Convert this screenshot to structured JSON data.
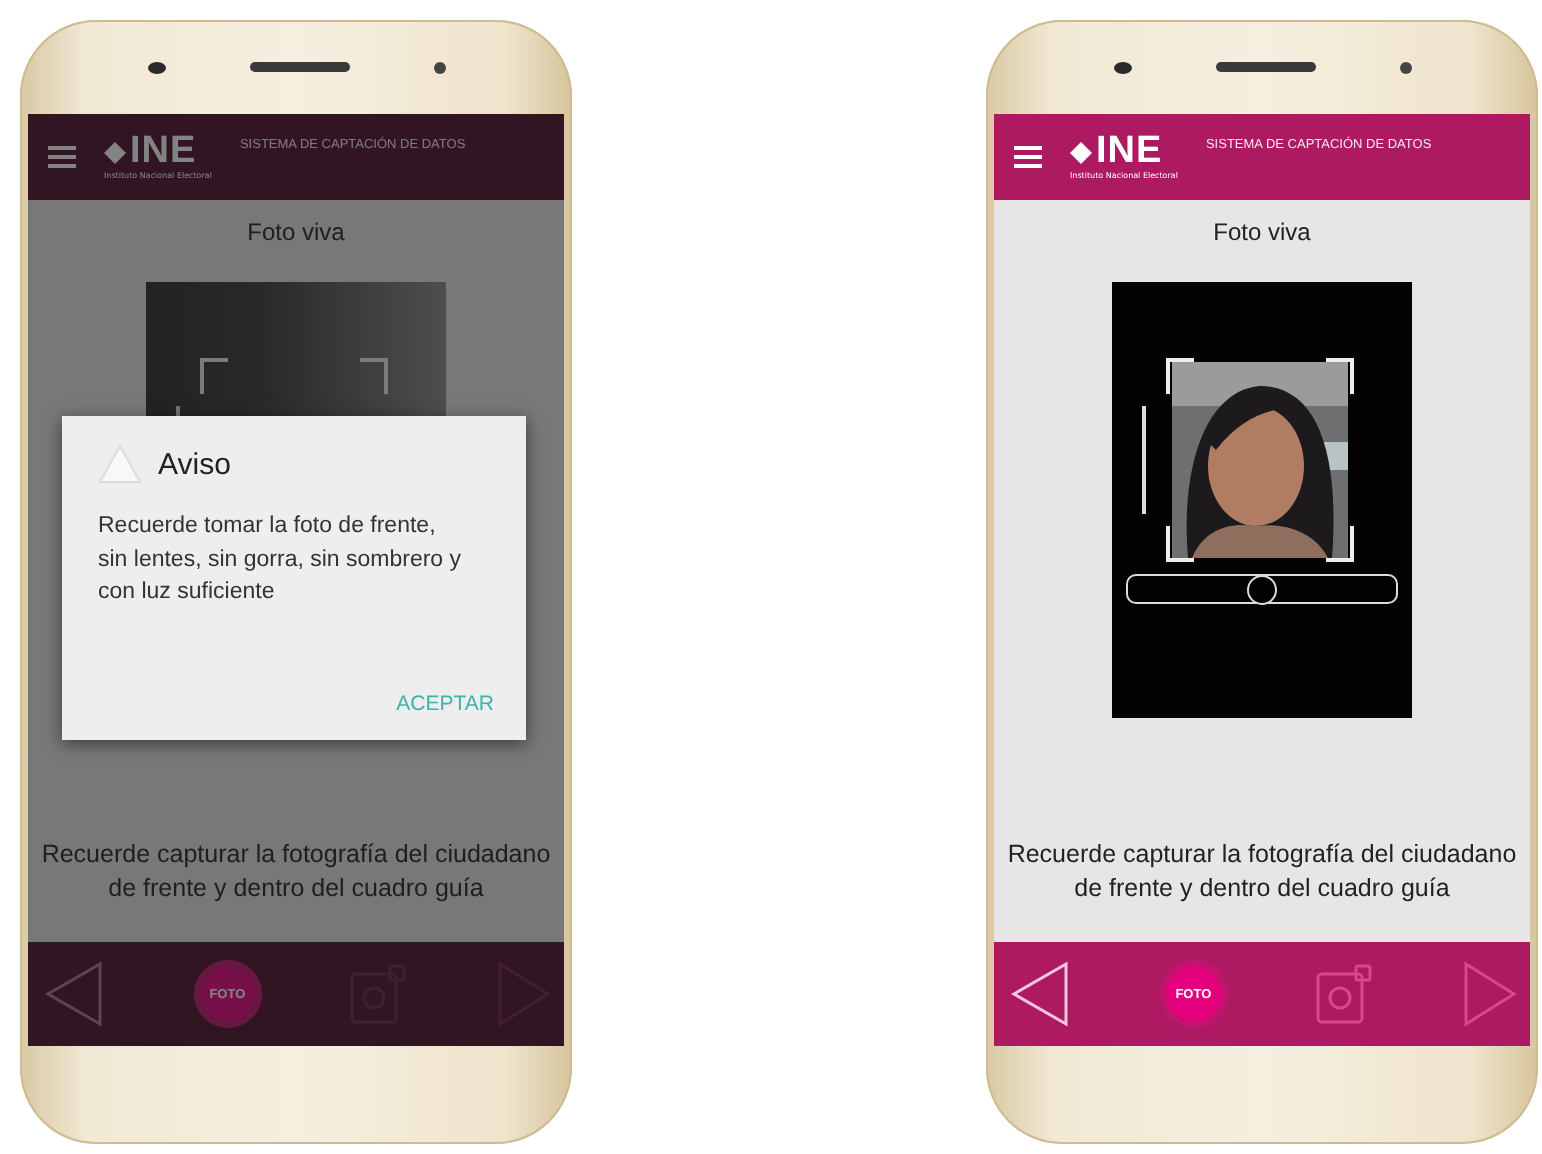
{
  "phones": [
    {
      "dimmed": true,
      "header": {
        "logo": "INE",
        "logo_subtitle": "Instituto Nacional Electoral",
        "title": "SISTEMA DE CAPTACIÓN DE DATOS"
      },
      "screen_title": "Foto viva",
      "camera": {
        "kind": "blank"
      },
      "instruction": "Recuerde capturar la fotografía del ciudadano de frente y dentro del cuadro guía",
      "toolbar": {
        "photo_button": "FOTO"
      },
      "dialog": {
        "title": "Aviso",
        "message": "Recuerde tomar la foto de frente, sin lentes, sin gorra, sin sombrero y con luz suficiente",
        "action": "ACEPTAR"
      }
    },
    {
      "dimmed": false,
      "header": {
        "logo": "INE",
        "logo_subtitle": "Instituto Nacional Electoral",
        "title": "SISTEMA DE CAPTACIÓN DE DATOS"
      },
      "screen_title": "Foto viva",
      "camera": {
        "kind": "picture",
        "slider": {
          "level": 0.5
        }
      },
      "instruction": "Recuerde capturar la fotografía del ciudadano de frente y dentro del cuadro guía",
      "toolbar": {
        "photo_button": "FOTO"
      }
    }
  ]
}
